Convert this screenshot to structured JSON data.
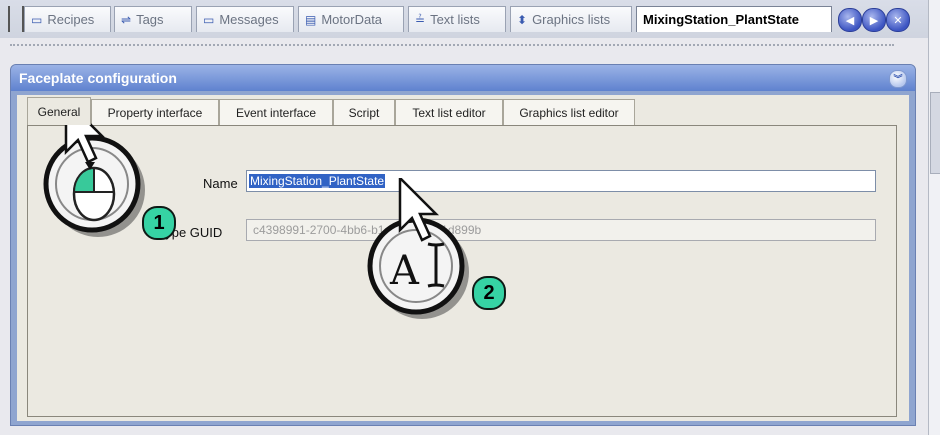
{
  "editor_tabs": [
    {
      "label": "Recipes",
      "icon": "window-icon"
    },
    {
      "label": "Tags",
      "icon": "tags-icon"
    },
    {
      "label": "Messages",
      "icon": "window-icon"
    },
    {
      "label": "MotorData",
      "icon": "data-icon"
    },
    {
      "label": "Text lists",
      "icon": "textlist-icon"
    },
    {
      "label": "Graphics lists",
      "icon": "graphicslist-icon"
    },
    {
      "label": "MixingStation_PlantState",
      "icon": "",
      "active": true
    }
  ],
  "panel": {
    "title": "Faceplate configuration",
    "tabs": [
      {
        "label": "General",
        "active": true
      },
      {
        "label": "Property interface"
      },
      {
        "label": "Event interface"
      },
      {
        "label": "Script"
      },
      {
        "label": "Text list editor"
      },
      {
        "label": "Graphics list editor"
      }
    ],
    "name_label": "Name",
    "name_value": "MixingStation_PlantState",
    "guid_label": "Type GUID",
    "guid_value": "c4398991-2700-4bb6-b1c4-0b3e5a1d899b"
  },
  "callouts": [
    {
      "number": "1",
      "meaning": "mouse click"
    },
    {
      "number": "2",
      "meaning": "text input"
    }
  ],
  "colors": {
    "panel_header": "#5f82cf",
    "selection": "#3163c5",
    "callout_badge": "#36d3a4"
  }
}
